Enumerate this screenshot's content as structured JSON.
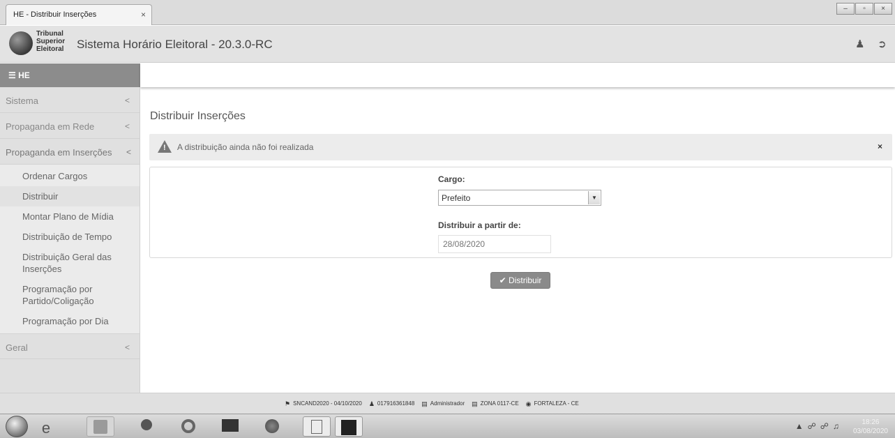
{
  "browser": {
    "tab_title": "HE - Distribuir Inserções",
    "tab_close": "×",
    "win_minimize": "–",
    "win_maximize": "▫",
    "win_close": "×"
  },
  "header": {
    "logo_line1": "Tribunal",
    "logo_line2": "Superior",
    "logo_line3": "Eleitoral",
    "title": "Sistema Horário Eleitoral - 20.3.0-RC",
    "user_icon": "user-icon",
    "logout_icon": "logout-icon"
  },
  "nav": {
    "menu_label": "HE"
  },
  "sidebar": {
    "items": [
      {
        "label": "Sistema",
        "chevron": "<"
      },
      {
        "label": "Propaganda em Rede",
        "chevron": "<"
      },
      {
        "label": "Propaganda em Inserções",
        "chevron": "<"
      },
      {
        "label": "Geral",
        "chevron": "<"
      }
    ],
    "submenu": [
      "Ordenar Cargos",
      "Distribuir",
      "Montar Plano de Mídia",
      "Distribuição de Tempo",
      "Distribuição Geral das Inserções",
      "Programação por Partido/Coligação",
      "Programação por Dia"
    ]
  },
  "main": {
    "page_title": "Distribuir Inserções",
    "alert_text": "A distribuição ainda não foi realizada",
    "alert_close": "×",
    "cargo_label": "Cargo:",
    "cargo_value": "Prefeito",
    "date_label": "Distribuir a partir de:",
    "date_placeholder": "28/08/2020",
    "button_label": "Distribuir"
  },
  "footer": {
    "item1": "SNCAND2020 - 04/10/2020",
    "item2": "017916361848",
    "item3": "Administrador",
    "item4": "ZONA 0117-CE",
    "item5": "FORTALEZA  -  CE"
  },
  "taskbar": {
    "time": "18:26",
    "date": "03/08/2020"
  },
  "colors": {
    "sidebar_bg": "#e0e0e0",
    "nav_dark": "#8c8c8c",
    "button_bg": "#8a8a8a",
    "alert_bg": "#ececec"
  }
}
